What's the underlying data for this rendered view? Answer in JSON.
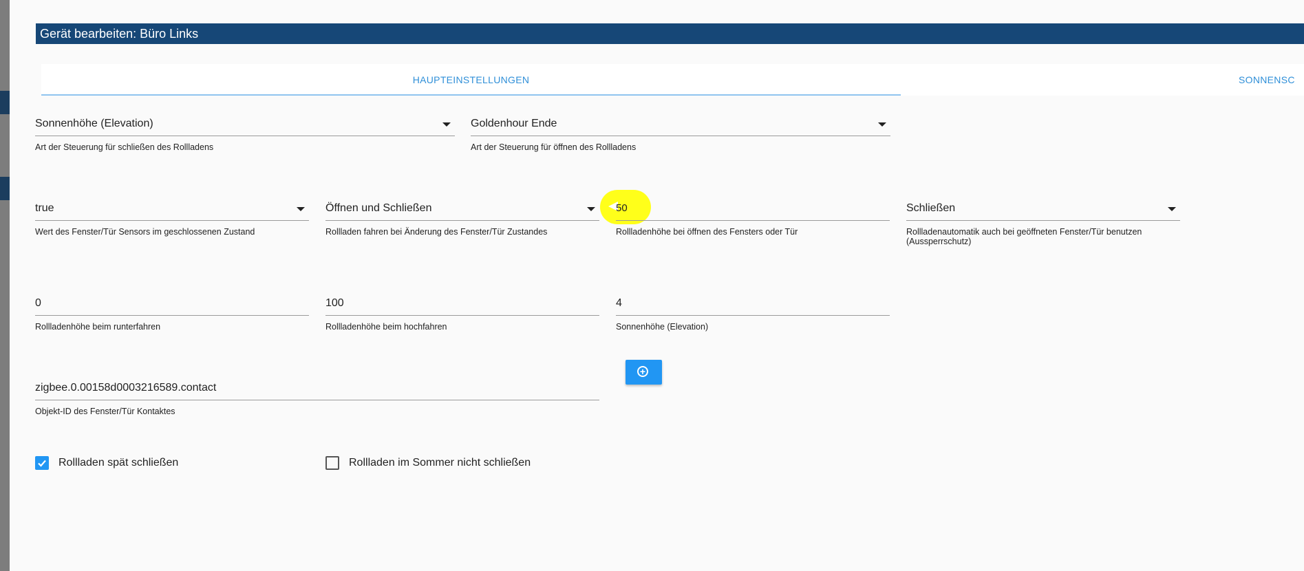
{
  "dialog": {
    "title": "Gerät bearbeiten: Büro Links"
  },
  "tabs": [
    {
      "label": "HAUPTEINSTELLUNGEN",
      "active": true
    },
    {
      "label": "SONNENSC",
      "active": false
    }
  ],
  "row1": {
    "close_control": {
      "value": "Sonnenhöhe (Elevation)",
      "help": "Art der Steuerung für schließen des Rollladens"
    },
    "open_control": {
      "value": "Goldenhour Ende",
      "help": "Art der Steuerung für öffnen des Rollladens"
    }
  },
  "row2": {
    "sensor_value": {
      "value": "true",
      "help": "Wert des Fenster/Tür Sensors im geschlossenen Zustand"
    },
    "drive_on_change": {
      "value": "Öffnen und Schließen",
      "help": "Rollladen fahren bei Änderung des Fenster/Tür Zustandes"
    },
    "window_open_height": {
      "value": "50",
      "help": "Rollladenhöhe bei öffnen des Fensters oder Tür"
    },
    "lockout": {
      "value": "Schließen",
      "help": "Rollladenautomatik auch bei geöffneten Fenster/Tür benutzen (Aussperrschutz)"
    }
  },
  "row3": {
    "down_height": {
      "value": "0",
      "help": "Rollladenhöhe beim runterfahren"
    },
    "up_height": {
      "value": "100",
      "help": "Rollladenhöhe beim hochfahren"
    },
    "elevation": {
      "value": "4",
      "help": "Sonnenhöhe (Elevation)"
    }
  },
  "row4": {
    "contact_id": {
      "value": "zigbee.0.00158d0003216589.contact",
      "help": "Objekt-ID des Fenster/Tür Kontaktes"
    }
  },
  "checkboxes": [
    {
      "label": "Rollladen spät schließen",
      "checked": true
    },
    {
      "label": "Rollladen im Sommer nicht schließen",
      "checked": false
    }
  ],
  "icons": {
    "add_button": "add-circle-icon",
    "checkmark": "checkmark-icon",
    "dropdown": "caret-down-icon"
  },
  "colors": {
    "titlebar": "#164777",
    "accent": "#2196f3",
    "tab_text": "#2f8fd8",
    "highlight": "#ffff1a"
  }
}
